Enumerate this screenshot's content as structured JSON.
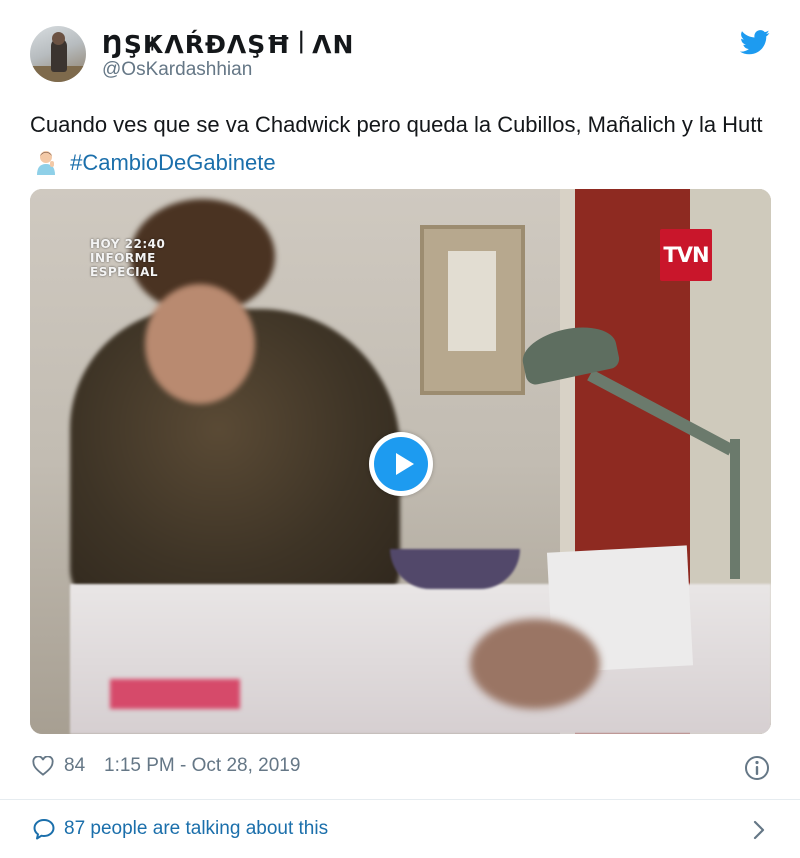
{
  "author": {
    "display_name": "ŊŞҜΛŔÐΛŞĦ꒐ΛΝ",
    "handle": "@OsKardashhian"
  },
  "tweet": {
    "text_part1": "Cuando ves que se va Chadwick pero queda la Cubillos, Mañalich y la Hutt",
    "emoji": "person-gesturing-emoji",
    "hashtag": "#CambioDeGabinete"
  },
  "media": {
    "overlay_text": "HOY 22:40\nINFORME\nESPECIAL",
    "channel_logo": "TVN",
    "play_icon": "play-icon"
  },
  "meta": {
    "like_count": "84",
    "timestamp": "1:15 PM - Oct 28, 2019"
  },
  "footer": {
    "talking_text": "87 people are talking about this"
  },
  "colors": {
    "accent": "#1d9bf0",
    "link": "#1b6fab",
    "muted": "#657786",
    "text": "#14171a",
    "divider": "#e6ecf0"
  }
}
